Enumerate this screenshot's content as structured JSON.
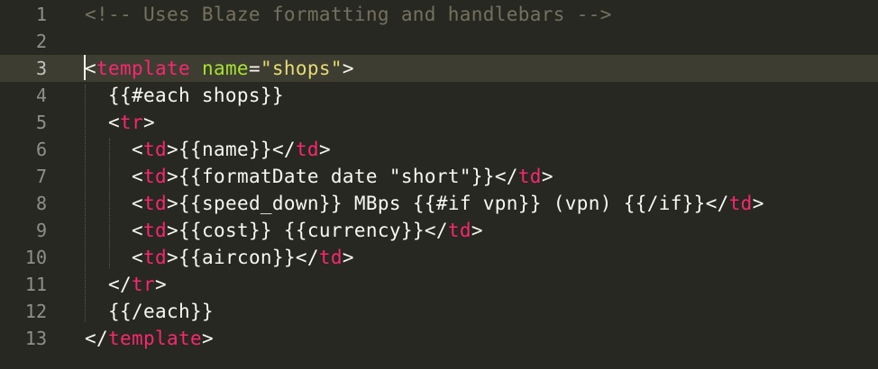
{
  "editor": {
    "theme": {
      "background": "#272822",
      "current_line": "#3e3d32",
      "comment": "#75715e",
      "tag": "#f92672",
      "attribute": "#a6e22e",
      "string": "#e6db74",
      "text": "#f8f8f2",
      "line_number": "#8f908a"
    },
    "current_line": 3,
    "lines": [
      {
        "number": "1",
        "tokens": [
          {
            "type": "comment",
            "text": "<!-- Uses Blaze formatting and handlebars -->"
          }
        ]
      },
      {
        "number": "2",
        "tokens": []
      },
      {
        "number": "3",
        "tokens": [
          {
            "type": "punct",
            "text": "<"
          },
          {
            "type": "tag",
            "text": "template"
          },
          {
            "type": "text",
            "text": " "
          },
          {
            "type": "attr",
            "text": "name"
          },
          {
            "type": "punct",
            "text": "="
          },
          {
            "type": "str",
            "text": "\"shops\""
          },
          {
            "type": "punct",
            "text": ">"
          }
        ]
      },
      {
        "number": "4",
        "tokens": [
          {
            "type": "text",
            "text": "  {{#each shops}}"
          }
        ]
      },
      {
        "number": "5",
        "tokens": [
          {
            "type": "text",
            "text": "  "
          },
          {
            "type": "punct",
            "text": "<"
          },
          {
            "type": "tag",
            "text": "tr"
          },
          {
            "type": "punct",
            "text": ">"
          }
        ]
      },
      {
        "number": "6",
        "tokens": [
          {
            "type": "text",
            "text": "    "
          },
          {
            "type": "punct",
            "text": "<"
          },
          {
            "type": "tag",
            "text": "td"
          },
          {
            "type": "punct",
            "text": ">"
          },
          {
            "type": "text",
            "text": "{{name}}"
          },
          {
            "type": "punct",
            "text": "</"
          },
          {
            "type": "tag",
            "text": "td"
          },
          {
            "type": "punct",
            "text": ">"
          }
        ]
      },
      {
        "number": "7",
        "tokens": [
          {
            "type": "text",
            "text": "    "
          },
          {
            "type": "punct",
            "text": "<"
          },
          {
            "type": "tag",
            "text": "td"
          },
          {
            "type": "punct",
            "text": ">"
          },
          {
            "type": "text",
            "text": "{{formatDate date \"short\"}}"
          },
          {
            "type": "punct",
            "text": "</"
          },
          {
            "type": "tag",
            "text": "td"
          },
          {
            "type": "punct",
            "text": ">"
          }
        ]
      },
      {
        "number": "8",
        "tokens": [
          {
            "type": "text",
            "text": "    "
          },
          {
            "type": "punct",
            "text": "<"
          },
          {
            "type": "tag",
            "text": "td"
          },
          {
            "type": "punct",
            "text": ">"
          },
          {
            "type": "text",
            "text": "{{speed_down}} MBps {{#if vpn}} (vpn) {{/if}}"
          },
          {
            "type": "punct",
            "text": "</"
          },
          {
            "type": "tag",
            "text": "td"
          },
          {
            "type": "punct",
            "text": ">"
          }
        ]
      },
      {
        "number": "9",
        "tokens": [
          {
            "type": "text",
            "text": "    "
          },
          {
            "type": "punct",
            "text": "<"
          },
          {
            "type": "tag",
            "text": "td"
          },
          {
            "type": "punct",
            "text": ">"
          },
          {
            "type": "text",
            "text": "{{cost}} {{currency}}"
          },
          {
            "type": "punct",
            "text": "</"
          },
          {
            "type": "tag",
            "text": "td"
          },
          {
            "type": "punct",
            "text": ">"
          }
        ]
      },
      {
        "number": "10",
        "tokens": [
          {
            "type": "text",
            "text": "    "
          },
          {
            "type": "punct",
            "text": "<"
          },
          {
            "type": "tag",
            "text": "td"
          },
          {
            "type": "punct",
            "text": ">"
          },
          {
            "type": "text",
            "text": "{{aircon}}"
          },
          {
            "type": "punct",
            "text": "</"
          },
          {
            "type": "tag",
            "text": "td"
          },
          {
            "type": "punct",
            "text": ">"
          }
        ]
      },
      {
        "number": "11",
        "tokens": [
          {
            "type": "text",
            "text": "  "
          },
          {
            "type": "punct",
            "text": "</"
          },
          {
            "type": "tag",
            "text": "tr"
          },
          {
            "type": "punct",
            "text": ">"
          }
        ]
      },
      {
        "number": "12",
        "tokens": [
          {
            "type": "text",
            "text": "  {{/each}}"
          }
        ]
      },
      {
        "number": "13",
        "tokens": [
          {
            "type": "punct",
            "text": "</"
          },
          {
            "type": "tag",
            "text": "template"
          },
          {
            "type": "punct",
            "text": ">"
          }
        ]
      }
    ]
  }
}
